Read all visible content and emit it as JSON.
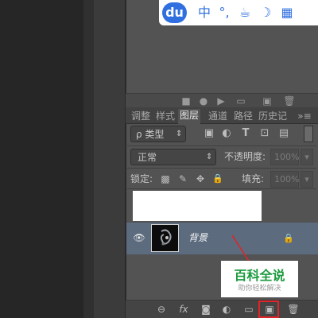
{
  "ime_toolbar": {
    "logo": "du",
    "items": [
      {
        "name": "chinese-mode-icon",
        "glyph": "中"
      },
      {
        "name": "punctuation-icon",
        "glyph": "°,"
      },
      {
        "name": "cup-icon",
        "glyph": "☕"
      },
      {
        "name": "moon-icon",
        "glyph": "☽"
      },
      {
        "name": "grid-icon",
        "glyph": "▦"
      }
    ]
  },
  "layers_panel": {
    "tabs": [
      "调整",
      "样式",
      "图层",
      "通道",
      "路径",
      "历史记"
    ],
    "active_tab": "图层",
    "filter": {
      "label": "ρ 类型",
      "arrow": "⇕"
    },
    "filter_icons": [
      "▣",
      "◐",
      "T",
      "⊡",
      "▤"
    ],
    "blend_mode": "正常",
    "opacity": {
      "label": "不透明度:",
      "value": "100%"
    },
    "lock": {
      "label": "锁定:",
      "icons": [
        "▩",
        "✎",
        "✥",
        "🔒"
      ]
    },
    "fill": {
      "label": "填充:",
      "value": "100%"
    },
    "layer": {
      "name": "背景",
      "visibility_icon": "👁",
      "lock_icon": "🔒"
    },
    "bottom_icons": [
      "⊖",
      "fx",
      "◙",
      "◐",
      "▭",
      "▣",
      "🗑"
    ]
  },
  "upper_toolbar_icons": [
    "■",
    "●",
    "▶",
    "▭",
    "▣",
    "🗑"
  ],
  "watermark": {
    "title": "百科全说",
    "subtitle": "助你轻松解决"
  },
  "colors": {
    "accent_highlight": "#e0242a",
    "watermark_green": "#1b9a3f",
    "ime_blue": "#2f6fe0"
  }
}
